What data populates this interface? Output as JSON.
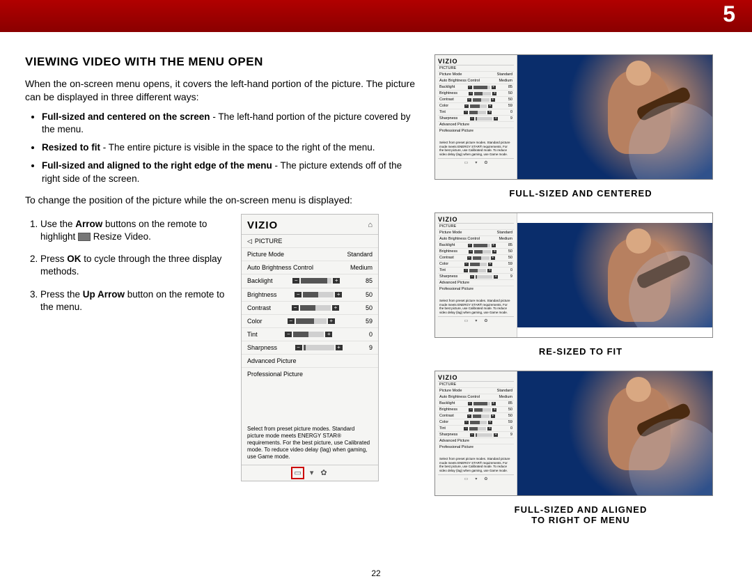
{
  "page": {
    "chapter": "5",
    "number": "22"
  },
  "heading": "VIEWING VIDEO WITH THE MENU OPEN",
  "intro": "When the on-screen menu opens, it covers the left-hand portion of the picture. The picture can be displayed in three different ways:",
  "bullets": [
    {
      "bold": "Full-sized and centered on the screen",
      "rest": " - The left-hand portion of the picture covered by the menu."
    },
    {
      "bold": "Resized to fit",
      "rest": " - The entire picture is visible in the space to the right of the menu."
    },
    {
      "bold": "Full-sized and aligned to the right edge of the menu",
      "rest": " - The picture extends off of the right side of the screen."
    }
  ],
  "changeText": "To change the position of the picture while the on-screen menu is displayed:",
  "steps": [
    {
      "pre": "Use the ",
      "b1": "Arrow",
      "mid": " buttons on the remote to highlight ",
      "icon": true,
      "post": " Resize Video."
    },
    {
      "pre": "Press ",
      "b1": "OK",
      "mid": " to cycle through the three display methods.",
      "icon": false,
      "post": ""
    },
    {
      "pre": "Press the ",
      "b1": "Up Arrow",
      "mid": " button on the remote to the menu.",
      "icon": false,
      "post": ""
    }
  ],
  "menu": {
    "brand": "VIZIO",
    "section": "PICTURE",
    "rows": [
      {
        "label": "Picture Mode",
        "value": "Standard",
        "type": "text"
      },
      {
        "label": "Auto Brightness Control",
        "value": "Medium",
        "type": "text"
      },
      {
        "label": "Backlight",
        "value": "85",
        "type": "slider",
        "pct": 85
      },
      {
        "label": "Brightness",
        "value": "50",
        "type": "slider",
        "pct": 50
      },
      {
        "label": "Contrast",
        "value": "50",
        "type": "slider",
        "pct": 50
      },
      {
        "label": "Color",
        "value": "59",
        "type": "slider",
        "pct": 59
      },
      {
        "label": "Tint",
        "value": "0",
        "type": "slider",
        "pct": 50
      },
      {
        "label": "Sharpness",
        "value": "9",
        "type": "slider",
        "pct": 9
      },
      {
        "label": "Advanced Picture",
        "value": "",
        "type": "link"
      },
      {
        "label": "Professional Picture",
        "value": "",
        "type": "link"
      }
    ],
    "help": "Select from preset picture modes. Standard picture mode meets ENERGY STAR® requirements. For the best picture, use Calibrated mode. To reduce video delay (lag) when gaming, use Game mode."
  },
  "captions": {
    "a": "FULL-SIZED AND CENTERED",
    "b": "RE-SIZED TO FIT",
    "c1": "FULL-SIZED AND ALIGNED",
    "c2": "TO RIGHT OF MENU"
  }
}
